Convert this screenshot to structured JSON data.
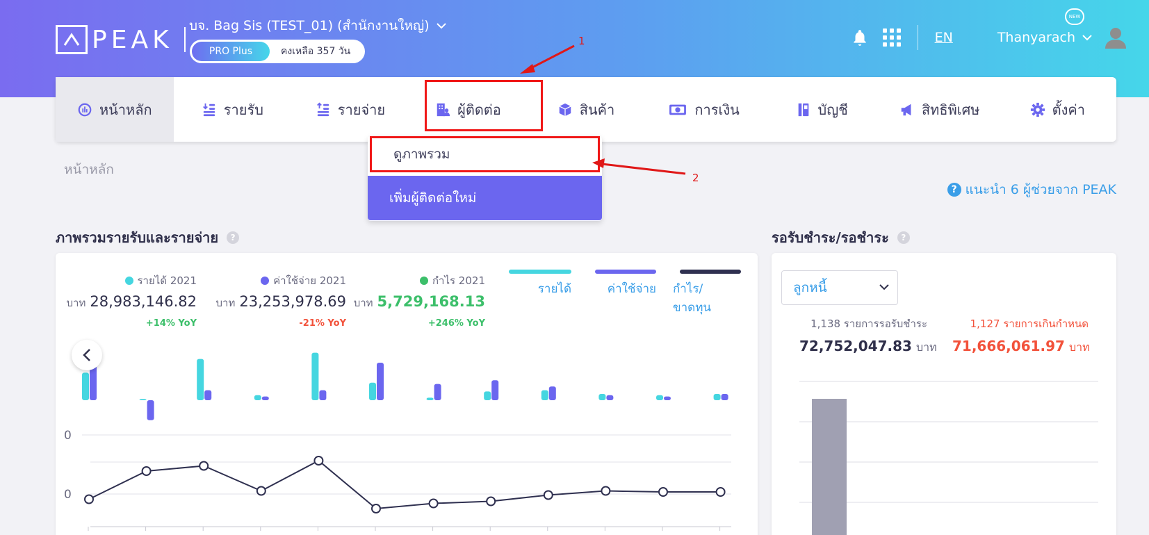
{
  "header": {
    "logo_text": "PEAK",
    "company_name": "บจ. Bag Sis (TEST_01) (สำนักงานใหญ่)",
    "plan_label": "PRO Plus",
    "plan_remaining": "คงเหลือ 357 วัน",
    "new_badge": "NEW",
    "language": "EN",
    "user_name": "Thanyarach"
  },
  "menu": {
    "items": [
      {
        "label": "หน้าหลัก",
        "icon": "dashboard-icon"
      },
      {
        "label": "รายรับ",
        "icon": "income-icon"
      },
      {
        "label": "รายจ่าย",
        "icon": "expense-icon"
      },
      {
        "label": "ผู้ติดต่อ",
        "icon": "contacts-icon"
      },
      {
        "label": "สินค้า",
        "icon": "product-box-icon"
      },
      {
        "label": "การเงิน",
        "icon": "money-icon"
      },
      {
        "label": "บัญชี",
        "icon": "ledger-icon"
      },
      {
        "label": "สิทธิพิเศษ",
        "icon": "megaphone-icon"
      },
      {
        "label": "ตั้งค่า",
        "icon": "gear-icon"
      }
    ]
  },
  "contacts_dropdown": {
    "view_all": "ดูภาพรวม",
    "add_new": "เพิ่มผู้ติดต่อใหม่"
  },
  "annotations": {
    "one": "1",
    "two": "2"
  },
  "breadcrumb": "หน้าหลัก",
  "help_link": "แนะนำ 6 ผู้ช่วยจาก PEAK",
  "overview": {
    "title": "ภาพรวมรายรับและรายจ่าย",
    "income": {
      "label": "รายได้ 2021",
      "unit": "บาท",
      "value": "28,983,146.82",
      "yoy": "+14% YoY",
      "color": "#45d6e0"
    },
    "expense": {
      "label": "ค่าใช้จ่าย 2021",
      "unit": "บาท",
      "value": "23,253,978.69",
      "yoy": "-21% YoY",
      "color": "#6b66ef"
    },
    "profit": {
      "label": "กำไร 2021",
      "unit": "บาท",
      "value": "5,729,168.13",
      "yoy": "+246% YoY",
      "color": "#3cbf6a"
    },
    "legend": [
      {
        "label": "รายได้",
        "color": "#45d6e0"
      },
      {
        "label": "ค่าใช้จ่าย",
        "color": "#6b66ef"
      },
      {
        "label": "กำไร/ขาดทุน",
        "color": "#2f3050"
      }
    ],
    "axis_zero_top": "0",
    "axis_zero_bottom": "0"
  },
  "chart_data": {
    "type": "bar",
    "series": [
      {
        "name": "รายได้",
        "values": [
          2.2,
          0.1,
          3.3,
          0.4,
          3.8,
          1.4,
          0.2,
          0.7,
          0.8,
          0.5,
          0.4,
          0.5
        ]
      },
      {
        "name": "ค่าใช้จ่าย",
        "values": [
          2.9,
          -1.6,
          0.8,
          0.3,
          0.8,
          3.0,
          1.3,
          1.6,
          1.1,
          0.4,
          0.3,
          0.5
        ]
      },
      {
        "name": "กำไร/ขาดทุน",
        "values": [
          -0.7,
          2.0,
          2.5,
          0.1,
          3.0,
          -1.6,
          -1.1,
          -0.9,
          -0.3,
          0.1,
          0.0,
          0.0
        ]
      }
    ]
  },
  "receivable": {
    "title": "รอรับชำระ/รอชำระ",
    "select_value": "ลูกหนี้",
    "pending_label": "1,138 รายการรอรับชำระ",
    "pending_value": "72,752,047.83",
    "overdue_label": "1,127 รายการเกินกำหนด",
    "overdue_value": "71,666,061.97",
    "unit": "บาท"
  }
}
